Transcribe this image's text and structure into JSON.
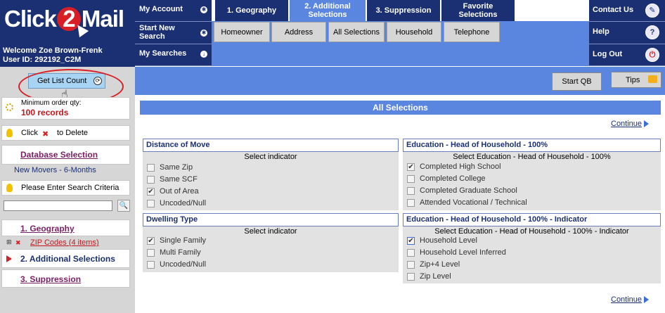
{
  "brand": {
    "logo_left": "Click",
    "logo_mid": "2",
    "logo_right": "Mail"
  },
  "user": {
    "welcome": "Welcome Zoe Brown-Frenk",
    "user_id": "User ID: 292192_C2M"
  },
  "leftnav": {
    "my_account": "My Account",
    "start_new_search": "Start New Search",
    "my_searches": "My Searches"
  },
  "tabs": [
    {
      "label": "1. Geography"
    },
    {
      "label": "2. Additional Selections"
    },
    {
      "label": "3. Suppression"
    },
    {
      "label": "Favorite Selections"
    }
  ],
  "subtabs": [
    "Homeowner",
    "Address",
    "All Selections",
    "Household",
    "Telephone"
  ],
  "rightnav": {
    "contact": "Contact Us",
    "help": "Help",
    "logout": "Log Out"
  },
  "toolbar": {
    "get_list_count": "Get List Count",
    "start_qb": "Start QB",
    "tips": "Tips"
  },
  "sidebar": {
    "min_order_label": "Minimum order qty:",
    "min_order_value": "100 records",
    "click_text": "Click",
    "to_delete": "to Delete",
    "database_selection": "Database Selection",
    "database_name": "New Movers - 6-Months",
    "enter_criteria": "Please Enter Search Criteria",
    "geography": "1. Geography",
    "zip_codes": "ZIP Codes (4 items)",
    "additional": "2. Additional Selections",
    "suppression": "3. Suppression"
  },
  "main": {
    "title": "All Selections",
    "continue": "Continue",
    "boxes": [
      {
        "title": "Distance of Move",
        "indicator": "Select indicator",
        "options": [
          {
            "label": "Same Zip",
            "checked": false
          },
          {
            "label": "Same SCF",
            "checked": false
          },
          {
            "label": "Out of Area",
            "checked": true
          },
          {
            "label": "Uncoded/Null",
            "checked": false
          }
        ]
      },
      {
        "title": "Education - Head of Household - 100%",
        "indicator": "Select Education - Head of Household - 100%",
        "options": [
          {
            "label": "Completed High School",
            "checked": true
          },
          {
            "label": "Completed College",
            "checked": false
          },
          {
            "label": "Completed Graduate School",
            "checked": false
          },
          {
            "label": "Attended Vocational / Technical",
            "checked": false
          }
        ]
      },
      {
        "title": "Dwelling Type",
        "indicator": "Select indicator",
        "options": [
          {
            "label": "Single Family",
            "checked": true
          },
          {
            "label": "Multi Family",
            "checked": false
          },
          {
            "label": "Uncoded/Null",
            "checked": false
          }
        ]
      },
      {
        "title": "Education - Head of Household - 100% - Indicator",
        "indicator": "Select Education - Head of Household - 100% - Indicator",
        "options": [
          {
            "label": "Household Level",
            "checked": true
          },
          {
            "label": "Household Level Inferred",
            "checked": false
          },
          {
            "label": "Zip+4 Level",
            "checked": false
          },
          {
            "label": "Zip Level",
            "checked": false
          }
        ]
      }
    ]
  },
  "colors": {
    "navy": "#1b2f73",
    "blue": "#5a86e0",
    "red": "#d81f26",
    "link": "#7b1f62"
  }
}
